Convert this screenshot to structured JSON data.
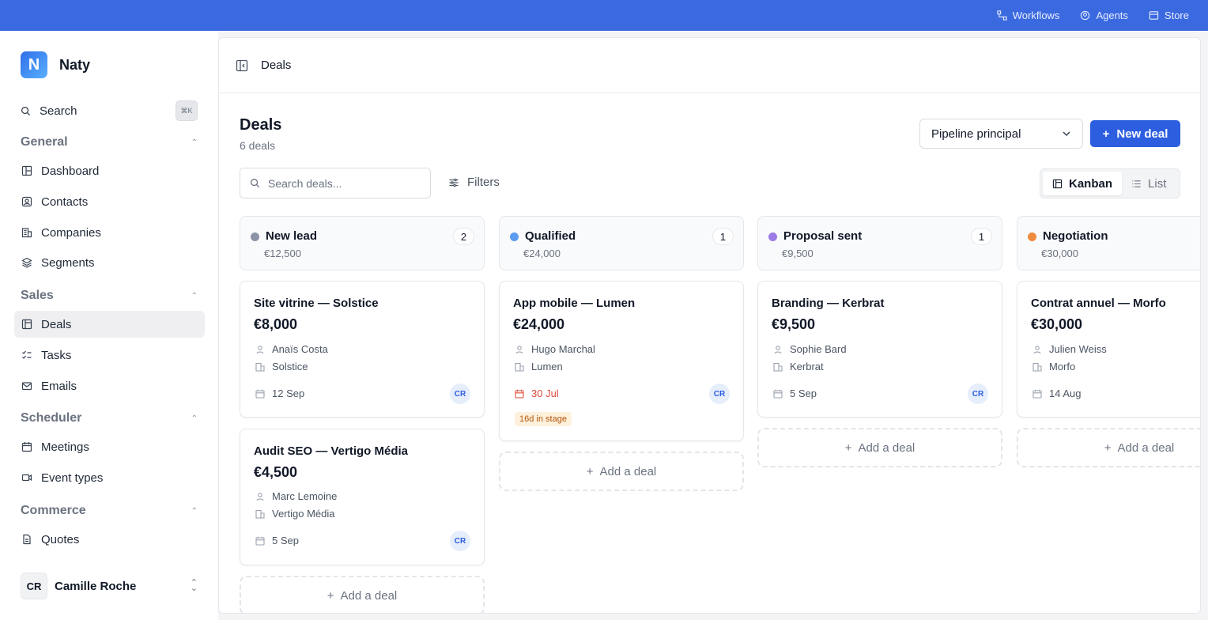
{
  "topbar": {
    "workflows": "Workflows",
    "agents": "Agents",
    "store": "Store"
  },
  "sidebar": {
    "brand": "Naty",
    "logo_letter": "N",
    "search_label": "Search",
    "search_shortcut": "⌘K",
    "sections": {
      "general": "General",
      "sales": "Sales",
      "scheduler": "Scheduler",
      "commerce": "Commerce"
    },
    "items": {
      "dashboard": "Dashboard",
      "contacts": "Contacts",
      "companies": "Companies",
      "segments": "Segments",
      "deals": "Deals",
      "tasks": "Tasks",
      "emails": "Emails",
      "meetings": "Meetings",
      "event_types": "Event types",
      "quotes": "Quotes"
    },
    "user": {
      "initials": "CR",
      "name": "Camille Roche"
    }
  },
  "header": {
    "breadcrumb": "Deals"
  },
  "page": {
    "title": "Deals",
    "subtitle": "6 deals",
    "pipeline_select": "Pipeline principal",
    "new_deal_label": "New deal",
    "search_placeholder": "Search deals...",
    "filters_label": "Filters",
    "view_kanban": "Kanban",
    "view_list": "List",
    "add_deal_label": "Add a deal"
  },
  "columns": [
    {
      "name": "New lead",
      "total": "€12,500",
      "count": "2",
      "color": "#8a94a6",
      "cards": [
        {
          "title": "Site vitrine — Solstice",
          "amount": "€8,000",
          "contact": "Anaïs Costa",
          "company": "Solstice",
          "date": "12 Sep",
          "owner": "CR"
        },
        {
          "title": "Audit SEO — Vertigo Média",
          "amount": "€4,500",
          "contact": "Marc Lemoine",
          "company": "Vertigo Média",
          "date": "5 Sep",
          "owner": "CR"
        }
      ]
    },
    {
      "name": "Qualified",
      "total": "€24,000",
      "count": "1",
      "color": "#5b9bf0",
      "cards": [
        {
          "title": "App mobile — Lumen",
          "amount": "€24,000",
          "contact": "Hugo Marchal",
          "company": "Lumen",
          "date": "30 Jul",
          "owner": "CR",
          "badge": "16d in stage"
        }
      ]
    },
    {
      "name": "Proposal sent",
      "total": "€9,500",
      "count": "1",
      "color": "#9b7be8",
      "cards": [
        {
          "title": "Branding — Kerbrat",
          "amount": "€9,500",
          "contact": "Sophie Bard",
          "company": "Kerbrat",
          "date": "5 Sep",
          "owner": "CR"
        }
      ]
    },
    {
      "name": "Negotiation",
      "total": "€30,000",
      "color": "#ef8a3e",
      "cards": [
        {
          "title": "Contrat annuel — Morfo",
          "amount": "€30,000",
          "contact": "Julien Weiss",
          "company": "Morfo",
          "date": "14 Aug"
        }
      ]
    }
  ]
}
